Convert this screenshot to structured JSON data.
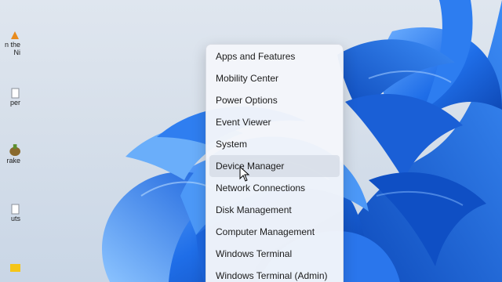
{
  "desktop": {
    "icons": [
      {
        "label_line1": "n the",
        "label_line2": "Ni",
        "icon": "shortcut-icon"
      },
      {
        "label_line1": "per",
        "label_line2": "",
        "icon": "document-icon"
      },
      {
        "label_line1": "rake",
        "label_line2": "",
        "icon": "app-icon"
      },
      {
        "label_line1": "uts",
        "label_line2": "",
        "icon": "document-icon"
      },
      {
        "label_line1": "",
        "label_line2": "",
        "icon": "folder-icon"
      }
    ]
  },
  "menu": {
    "items": [
      {
        "label": "Apps and Features"
      },
      {
        "label": "Mobility Center"
      },
      {
        "label": "Power Options"
      },
      {
        "label": "Event Viewer"
      },
      {
        "label": "System"
      },
      {
        "label": "Device Manager"
      },
      {
        "label": "Network Connections"
      },
      {
        "label": "Disk Management"
      },
      {
        "label": "Computer Management"
      },
      {
        "label": "Windows Terminal"
      },
      {
        "label": "Windows Terminal (Admin)"
      }
    ],
    "hovered_item": "Device Manager"
  },
  "colors": {
    "wallpaper_bloom": "#1f6ee8",
    "wallpaper_bloom_light": "#5aa0f7",
    "wallpaper_bloom_dark": "#0a3fa8",
    "menu_background": "#f4f6fa"
  }
}
